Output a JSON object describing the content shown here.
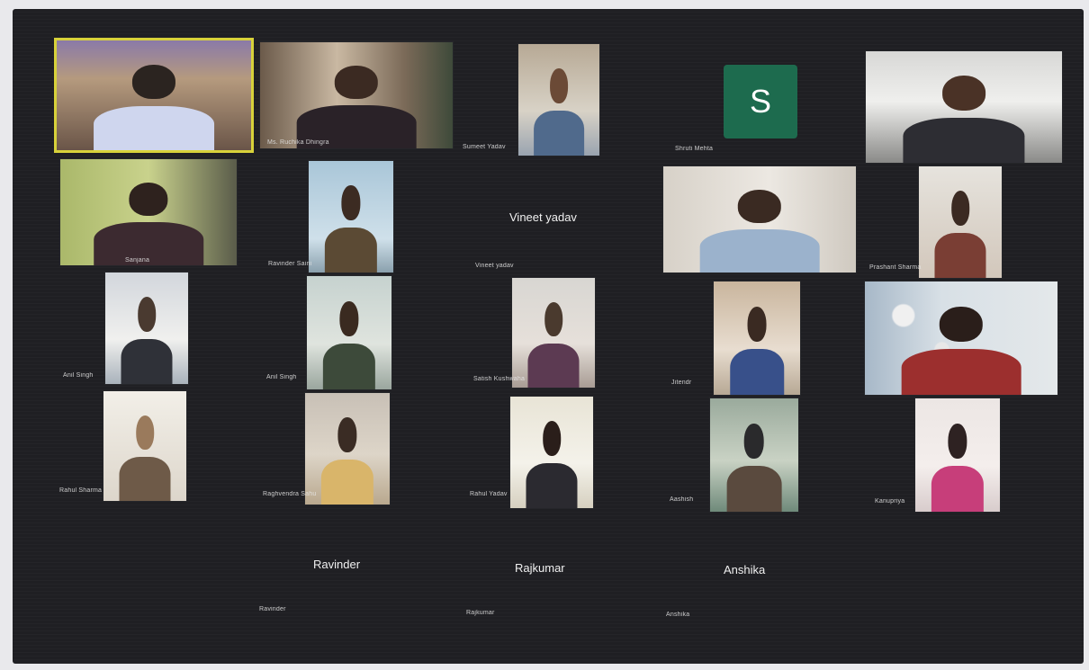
{
  "meeting": {
    "participants": [
      {
        "id": "p1",
        "name": ""
      },
      {
        "id": "p2",
        "name": "Ms. Ruchika Dhingra"
      },
      {
        "id": "p3",
        "name": "Sumeet Yadav"
      },
      {
        "id": "p4",
        "name": "Shruti Mehta",
        "initial": "S"
      },
      {
        "id": "p5",
        "name": ""
      },
      {
        "id": "p6",
        "name": "Sanjana"
      },
      {
        "id": "p7",
        "name": "Ravinder Saini"
      },
      {
        "id": "p8",
        "name": "Vineet yadav",
        "label": "Vineet yadav",
        "small_label": "Vineet yadav"
      },
      {
        "id": "p9",
        "name": ""
      },
      {
        "id": "p10",
        "name": "Prashant Sharma"
      },
      {
        "id": "p11",
        "name": "Anil Singh"
      },
      {
        "id": "p12",
        "name": "Anil Singh"
      },
      {
        "id": "p13",
        "name": "Satish Kushwaha"
      },
      {
        "id": "p14",
        "name": "Jitendr"
      },
      {
        "id": "p15",
        "name": ""
      },
      {
        "id": "p16",
        "name": "Rahul Sharma"
      },
      {
        "id": "p17",
        "name": "Raghvendra Sahu"
      },
      {
        "id": "p18",
        "name": "Rahul Yadav"
      },
      {
        "id": "p19",
        "name": "Aashish"
      },
      {
        "id": "p20",
        "name": "Kanupriya"
      },
      {
        "id": "p21",
        "name": "Ravinder",
        "label": "Ravinder",
        "small_label": "Ravinder"
      },
      {
        "id": "p22",
        "name": "Rajkumar",
        "label": "Rajkumar",
        "small_label": "Rajkumar"
      },
      {
        "id": "p23",
        "name": "Anshika",
        "label": "Anshika",
        "small_label": "Anshika"
      }
    ]
  },
  "colors": {
    "background": "#1f1f23",
    "active_speaker_border": "#d8d23a",
    "avatar_green": "#1d6b4e"
  },
  "icons": [
    "participant-avatar-initial"
  ]
}
